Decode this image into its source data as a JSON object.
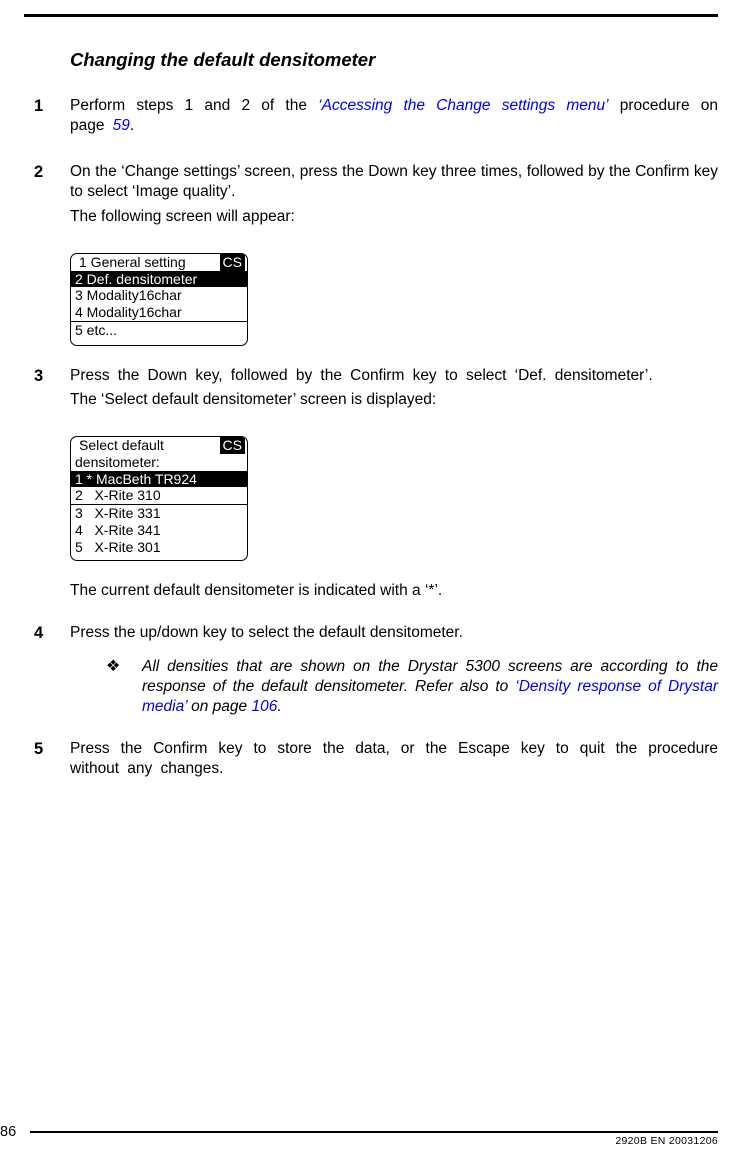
{
  "title": "Changing the default densitometer",
  "steps": {
    "s1": {
      "num": "1",
      "pre": "Perform steps 1 and 2 of the ",
      "link": "‘Accessing the Change settings menu’",
      "post": " procedure on page ",
      "page": "59",
      "tail": "."
    },
    "s2": {
      "num": "2",
      "p1": "On the ‘Change settings’ screen, press the Down key three times, followed by the Confirm key to select ‘Image quality’.",
      "p2": "The following screen will appear:"
    },
    "s3": {
      "num": "3",
      "p1": "Press the Down key, followed by the Confirm key to select ‘Def. densitometer’.",
      "p2": "The ‘Select default densitometer’ screen is displayed:",
      "p3": "The current default densitometer is indicated with a ‘*’."
    },
    "s4": {
      "num": "4",
      "p1": "Press the up/down key to select the default densitometer."
    },
    "s5": {
      "num": "5",
      "p1": "Press the Confirm key to store the data, or the Escape key to quit the procedure without any changes."
    }
  },
  "note": {
    "pre": "All densities that are shown on the Drystar 5300 screens are according to the response of the default densitometer. Refer also to ",
    "link": "‘Density response of Drystar media’",
    "mid": " on page ",
    "page": "106",
    "tail": "."
  },
  "lcd1": {
    "r1_left": "1 General setting",
    "cs": "CS",
    "r2": "2 Def. densitometer",
    "r3": "3 Modality16char",
    "r4": "4 Modality16char",
    "r5": "5 etc..."
  },
  "lcd2": {
    "h1": "Select default",
    "cs": "CS",
    "h2": "densitometer:",
    "r1": "1 * MacBeth TR924",
    "r2": "2   X-Rite 310",
    "r3": "3   X-Rite 331",
    "r4": "4   X-Rite 341",
    "r5": "5   X-Rite 301"
  },
  "footer": {
    "page": "86",
    "docid": "2920B EN 20031206"
  }
}
